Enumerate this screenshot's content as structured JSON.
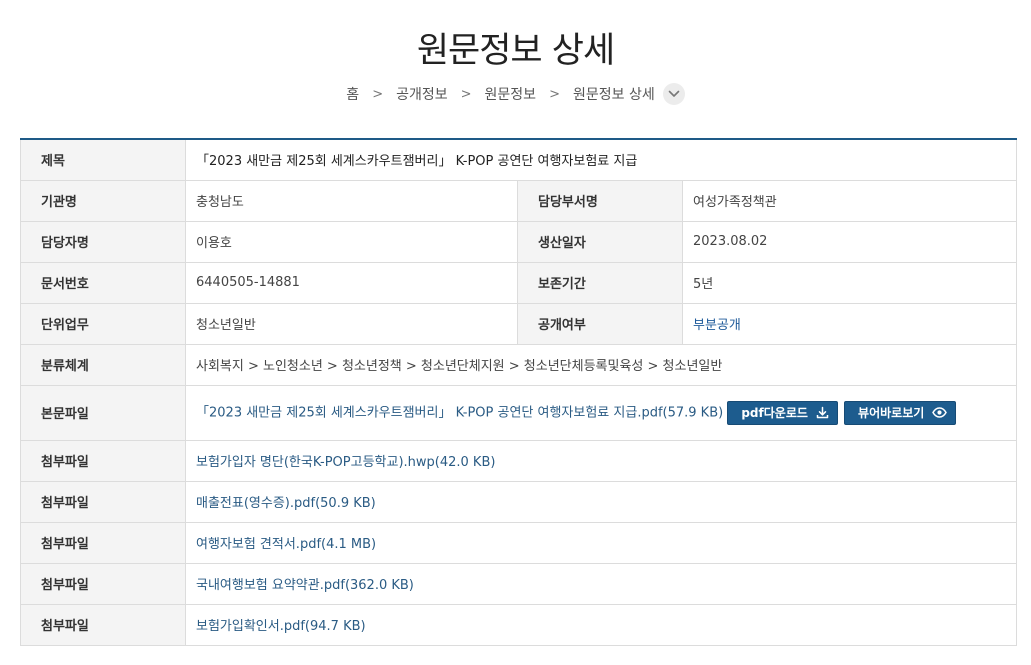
{
  "page": {
    "title": "원문정보 상세"
  },
  "breadcrumb": {
    "items": [
      "홈",
      "공개정보",
      "원문정보",
      "원문정보 상세"
    ],
    "separator": ">"
  },
  "detail": {
    "title_label": "제목",
    "title_value": "「2023 새만금 제25회 세계스카우트잼버리」 K-POP 공연단 여행자보험료 지급",
    "agency_label": "기관명",
    "agency_value": "충청남도",
    "dept_label": "담당부서명",
    "dept_value": "여성가족정책관",
    "person_label": "담당자명",
    "person_value": "이용호",
    "date_label": "생산일자",
    "date_value": "2023.08.02",
    "docno_label": "문서번호",
    "docno_value": "6440505-14881",
    "retention_label": "보존기간",
    "retention_value": "5년",
    "task_label": "단위업무",
    "task_value": "청소년일반",
    "disclosure_label": "공개여부",
    "disclosure_value": "부분공개",
    "category_label": "분류체계",
    "category_value": "사회복지 > 노인청소년 > 청소년정책 > 청소년단체지원 > 청소년단체등록및육성 > 청소년일반",
    "body_file_label": "본문파일",
    "body_file_value": "「2023 새만금 제25회 세계스카우트잼버리」 K-POP 공연단 여행자보험료 지급.pdf(57.9 KB)",
    "pdf_download_label": "pdf다운로드",
    "viewer_label": "뷰어바로보기",
    "attachment_label": "첨부파일",
    "attachments": [
      "보험가입자 명단(한국K-POP고등학교).hwp(42.0 KB)",
      "매출전표(영수증).pdf(50.9 KB)",
      "여행자보험 견적서.pdf(4.1 MB)",
      "국내여행보험 요약약관.pdf(362.0 KB)",
      "보험가입확인서.pdf(94.7 KB)"
    ]
  },
  "icons": {
    "download": "download-icon",
    "viewer": "eye-icon",
    "expand": "chevron-down-icon"
  },
  "colors": {
    "accent": "#1d5c8e",
    "link": "#2a5b84",
    "header_bg": "#f4f4f4"
  }
}
